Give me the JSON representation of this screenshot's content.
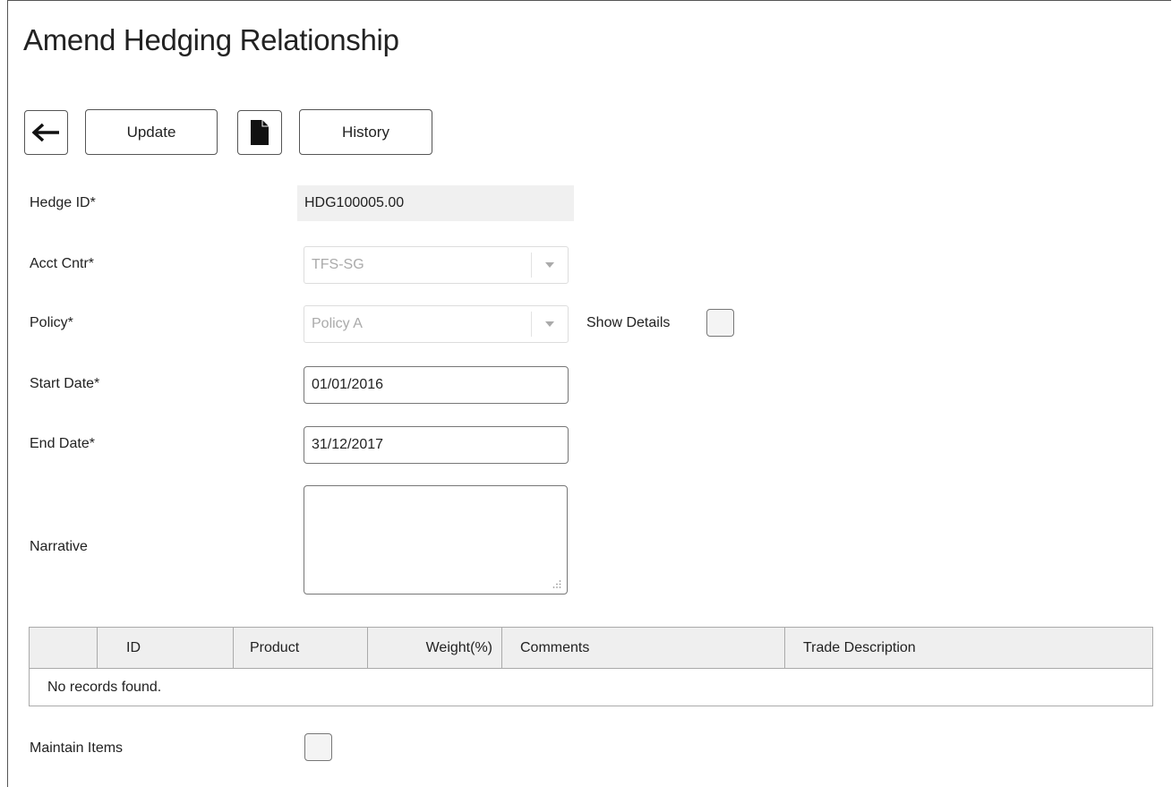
{
  "page": {
    "title": "Amend Hedging Relationship"
  },
  "toolbar": {
    "back_icon": "arrow-left-icon",
    "update_label": "Update",
    "document_icon": "document-icon",
    "history_label": "History"
  },
  "form": {
    "hedge_id": {
      "label": "Hedge ID*",
      "value": "HDG100005.00"
    },
    "acct_cntr": {
      "label": "Acct Cntr*",
      "value": "TFS-SG"
    },
    "policy": {
      "label": "Policy*",
      "value": "Policy A"
    },
    "show_details": {
      "label": "Show Details",
      "checked": false
    },
    "start_date": {
      "label": "Start Date*",
      "value": "01/01/2016"
    },
    "end_date": {
      "label": "End Date*",
      "value": "31/12/2017"
    },
    "narrative": {
      "label": "Narrative",
      "value": ""
    },
    "maintain_items": {
      "label": "Maintain Items",
      "checked": false
    }
  },
  "table": {
    "columns": [
      "",
      "ID",
      "Product",
      "Weight(%)",
      "Comments",
      "Trade Description"
    ],
    "empty_message": "No records found."
  },
  "colors": {
    "readonly_bg": "#f0f0f0",
    "header_bg": "#efefef",
    "border": "#777777"
  }
}
